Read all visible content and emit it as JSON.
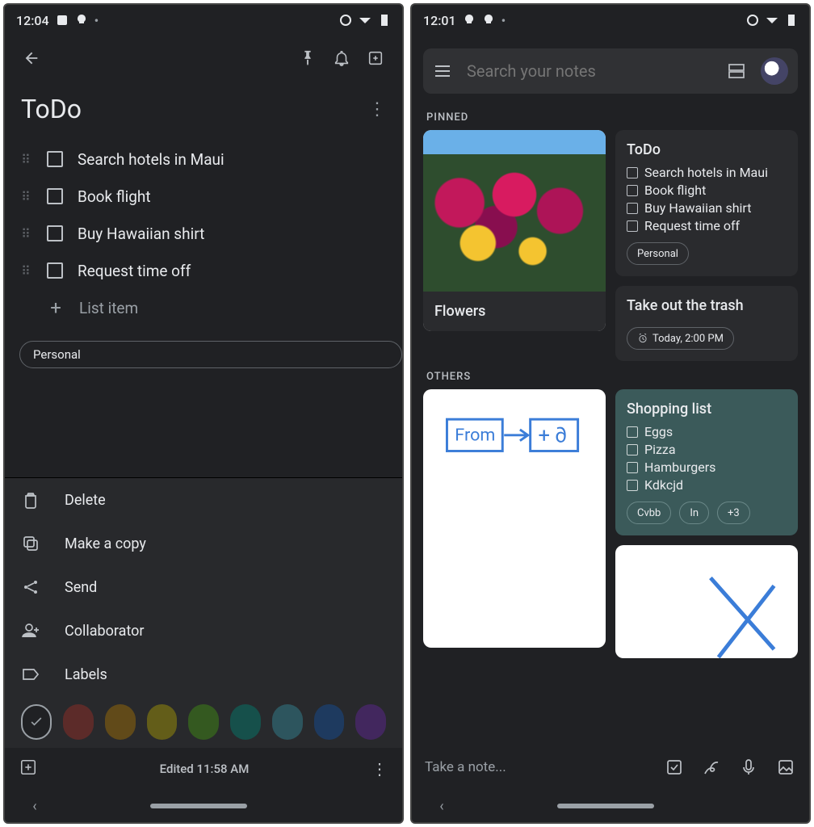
{
  "left": {
    "status_time": "12:04",
    "title": "ToDo",
    "list": {
      "items": [
        "Search hotels in Maui",
        "Book flight",
        "Buy Hawaiian shirt",
        "Request time off"
      ],
      "placeholder": "List item"
    },
    "label_chip": "Personal",
    "sheet": {
      "delete": "Delete",
      "copy": "Make a copy",
      "send": "Send",
      "collab": "Collaborator",
      "labels": "Labels"
    },
    "colors": [
      "#5c2b29",
      "#614a19",
      "#635d19",
      "#345920",
      "#16504b",
      "#2d555e",
      "#1e3a5f",
      "#42275e"
    ],
    "footer_text": "Edited 11:58 AM"
  },
  "right": {
    "status_time": "12:01",
    "search_placeholder": "Search your notes",
    "section_pinned": "PINNED",
    "section_others": "OTHERS",
    "flowers_title": "Flowers",
    "todo": {
      "title": "ToDo",
      "items": [
        "Search hotels in Maui",
        "Book flight",
        "Buy Hawaiian shirt",
        "Request time off"
      ],
      "chip": "Personal"
    },
    "trash": {
      "title": "Take out the trash",
      "reminder": "Today, 2:00 PM"
    },
    "shopping": {
      "title": "Shopping list",
      "items": [
        "Eggs",
        "Pizza",
        "Hamburgers",
        "Kdkcjd"
      ],
      "chips": [
        "Cvbb",
        "In",
        "+3"
      ]
    },
    "takebar_placeholder": "Take a note..."
  }
}
